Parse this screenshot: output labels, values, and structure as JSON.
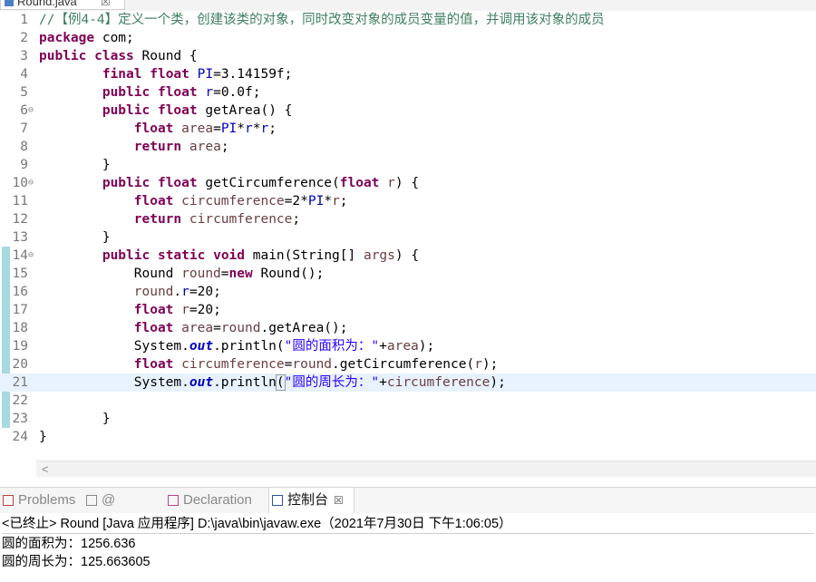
{
  "editor": {
    "tab_title": "Round.java",
    "tab_close": "☒"
  },
  "code": [
    {
      "n": "1",
      "html": "<span class=\"cm\">//【例4-4】定义一个类，创建该类的对象，同时改变对象的成员变量的值，并调用该对象的成员</span>"
    },
    {
      "n": "2",
      "html": "<span class=\"kw\">package</span> com;"
    },
    {
      "n": "3",
      "html": "<span class=\"kw\">public</span> <span class=\"kw\">class</span> Round {"
    },
    {
      "n": "4",
      "html": "        <span class=\"kw\">final</span> <span class=\"kw\">float</span> <span class=\"fld\">PI</span>=3.14159f;"
    },
    {
      "n": "5",
      "html": "        <span class=\"kw\">public</span> <span class=\"kw\">float</span> <span class=\"fld\">r</span>=0.0f;"
    },
    {
      "n": "6",
      "fold": true,
      "html": "        <span class=\"kw\">public</span> <span class=\"kw\">float</span> getArea() {"
    },
    {
      "n": "7",
      "html": "            <span class=\"kw\">float</span> <span class=\"var\">area</span>=<span class=\"fld\">PI</span>*<span class=\"fld\">r</span>*<span class=\"fld\">r</span>;"
    },
    {
      "n": "8",
      "html": "            <span class=\"kw\">return</span> <span class=\"var\">area</span>;"
    },
    {
      "n": "9",
      "html": "        }"
    },
    {
      "n": "10",
      "fold": true,
      "html": "        <span class=\"kw\">public</span> <span class=\"kw\">float</span> getCircumference(<span class=\"kw\">float</span> <span class=\"var\">r</span>) {"
    },
    {
      "n": "11",
      "html": "            <span class=\"kw\">float</span> <span class=\"var\">circumference</span>=2*<span class=\"fld\">PI</span>*<span class=\"var\">r</span>;"
    },
    {
      "n": "12",
      "html": "            <span class=\"kw\">return</span> <span class=\"var\">circumference</span>;"
    },
    {
      "n": "13",
      "html": "        }"
    },
    {
      "n": "14",
      "fold": true,
      "html": "        <span class=\"kw\">public</span> <span class=\"kw\">static</span> <span class=\"kw\">void</span> main(String[] <span class=\"var\">args</span>) {"
    },
    {
      "n": "15",
      "html": "            Round <span class=\"var\">round</span>=<span class=\"kw\">new</span> Round();"
    },
    {
      "n": "16",
      "html": "            <span class=\"var\">round</span>.<span class=\"fld\">r</span>=20;"
    },
    {
      "n": "17",
      "html": "            <span class=\"kw\">float</span> <span class=\"var\">r</span>=20;"
    },
    {
      "n": "18",
      "html": "            <span class=\"kw\">float</span> <span class=\"var\">area</span>=<span class=\"var\">round</span>.getArea();"
    },
    {
      "n": "19",
      "html": "            System.<span class=\"st\">out</span>.println(<span class=\"str\">\"圆的面积为：\"</span>+<span class=\"var\">area</span>);"
    },
    {
      "n": "20",
      "html": "            <span class=\"kw\">float</span> <span class=\"var\">circumference</span>=<span class=\"var\">round</span>.getCircumference(<span class=\"var\">r</span>);"
    },
    {
      "n": "21",
      "current": true,
      "html": "            System.<span class=\"st\">out</span>.println<span class=\"bracket\">(</span><span class=\"str\">\"圆的周长为：\"</span>+<span class=\"var\">circumference</span>);"
    },
    {
      "n": "22",
      "html": ""
    },
    {
      "n": "23",
      "html": "        }"
    },
    {
      "n": "24",
      "html": "}"
    }
  ],
  "views": {
    "tabs": [
      {
        "label": "Problems",
        "icon": "problems-icon",
        "active": false
      },
      {
        "label": "@ Javadoc",
        "icon": "javadoc-icon",
        "active": false
      },
      {
        "label": "Declaration",
        "icon": "declaration-icon",
        "active": false
      },
      {
        "label": "控制台",
        "icon": "console-icon",
        "active": true
      }
    ],
    "close": "☒"
  },
  "console": {
    "header": "<已终止> Round [Java 应用程序] D:\\java\\bin\\javaw.exe（2021年7月30日 下午1:06:05）",
    "lines": [
      "圆的面积为：1256.636",
      "圆的周长为：125.663605"
    ]
  },
  "colors": {
    "keyword": "#7f0055",
    "comment": "#3f7f5f",
    "field": "#0000c0",
    "local_var": "#6a3e3e",
    "string": "#2a00ff",
    "current_line": "#e8f2fe"
  }
}
